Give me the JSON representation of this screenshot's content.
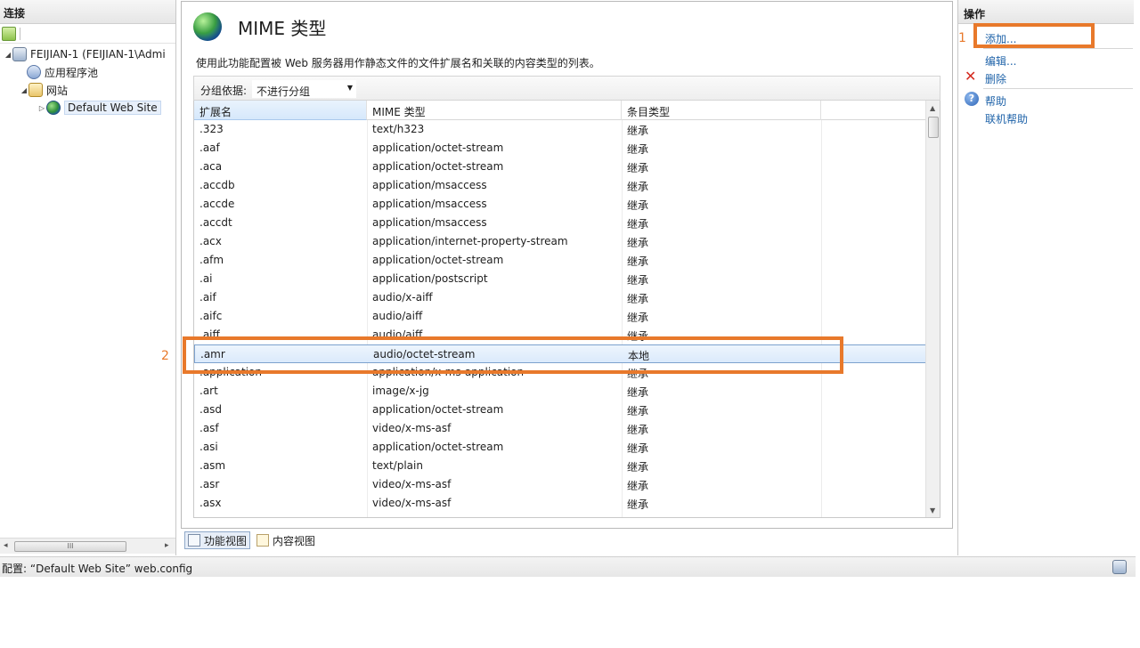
{
  "connections": {
    "header": "连接",
    "tree": {
      "server": "FEIJIAN-1 (FEIJIAN-1\\Admi",
      "app_pools": "应用程序池",
      "sites": "网站",
      "default_site": "Default Web Site"
    },
    "hscroll_grip": "III"
  },
  "feature": {
    "title": "MIME 类型",
    "description": "使用此功能配置被 Web 服务器用作静态文件的文件扩展名和关联的内容类型的列表。",
    "group_by_label": "分组依据:",
    "group_by_value": "不进行分组",
    "columns": [
      "扩展名",
      "MIME 类型",
      "条目类型"
    ],
    "rows": [
      {
        "ext": ".323",
        "mime": "text/h323",
        "type": "继承"
      },
      {
        "ext": ".aaf",
        "mime": "application/octet-stream",
        "type": "继承"
      },
      {
        "ext": ".aca",
        "mime": "application/octet-stream",
        "type": "继承"
      },
      {
        "ext": ".accdb",
        "mime": "application/msaccess",
        "type": "继承"
      },
      {
        "ext": ".accde",
        "mime": "application/msaccess",
        "type": "继承"
      },
      {
        "ext": ".accdt",
        "mime": "application/msaccess",
        "type": "继承"
      },
      {
        "ext": ".acx",
        "mime": "application/internet-property-stream",
        "type": "继承"
      },
      {
        "ext": ".afm",
        "mime": "application/octet-stream",
        "type": "继承"
      },
      {
        "ext": ".ai",
        "mime": "application/postscript",
        "type": "继承"
      },
      {
        "ext": ".aif",
        "mime": "audio/x-aiff",
        "type": "继承"
      },
      {
        "ext": ".aifc",
        "mime": "audio/aiff",
        "type": "继承"
      },
      {
        "ext": ".aiff",
        "mime": "audio/aiff",
        "type": "继承"
      },
      {
        "ext": ".amr",
        "mime": "audio/octet-stream",
        "type": "本地"
      },
      {
        "ext": ".application",
        "mime": "application/x-ms-application",
        "type": "继承"
      },
      {
        "ext": ".art",
        "mime": "image/x-jg",
        "type": "继承"
      },
      {
        "ext": ".asd",
        "mime": "application/octet-stream",
        "type": "继承"
      },
      {
        "ext": ".asf",
        "mime": "video/x-ms-asf",
        "type": "继承"
      },
      {
        "ext": ".asi",
        "mime": "application/octet-stream",
        "type": "继承"
      },
      {
        "ext": ".asm",
        "mime": "text/plain",
        "type": "继承"
      },
      {
        "ext": ".asr",
        "mime": "video/x-ms-asf",
        "type": "继承"
      },
      {
        "ext": ".asx",
        "mime": "video/x-ms-asf",
        "type": "继承"
      }
    ],
    "selected_ext": ".amr"
  },
  "view_tabs": {
    "features": "功能视图",
    "content": "内容视图"
  },
  "actions": {
    "header": "操作",
    "add": "添加...",
    "edit": "编辑...",
    "remove": "删除",
    "help": "帮助",
    "online_help": "联机帮助"
  },
  "status": {
    "text": "配置: “Default Web Site”  web.config"
  },
  "annotations": {
    "one": "1",
    "two": "2",
    "color": "#e8792b"
  }
}
